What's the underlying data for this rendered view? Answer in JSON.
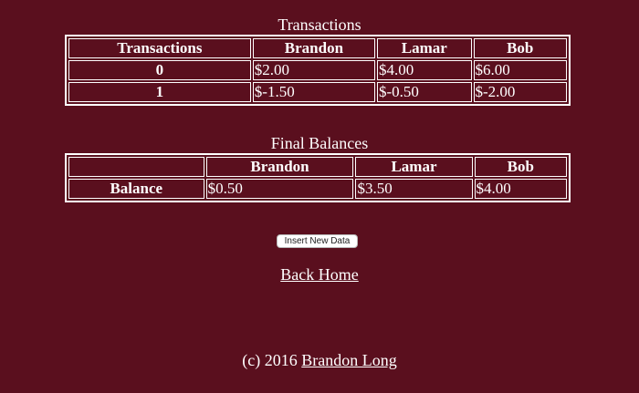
{
  "transactions": {
    "caption": "Transactions",
    "headers": [
      "Transactions",
      "Brandon",
      "Lamar",
      "Bob"
    ],
    "rows": [
      {
        "label": "0",
        "values": [
          "$2.00",
          "$4.00",
          "$6.00"
        ]
      },
      {
        "label": "1",
        "values": [
          "$-1.50",
          "$-0.50",
          "$-2.00"
        ]
      }
    ]
  },
  "balances": {
    "caption": "Final Balances",
    "headers": [
      "",
      "Brandon",
      "Lamar",
      "Bob"
    ],
    "rows": [
      {
        "label": "Balance",
        "values": [
          "$0.50",
          "$3.50",
          "$4.00"
        ]
      }
    ]
  },
  "insert_button": "Insert New Data",
  "back_home": "Back Home",
  "footer": {
    "prefix": "(c) 2016 ",
    "author_link": "Brandon Long"
  }
}
